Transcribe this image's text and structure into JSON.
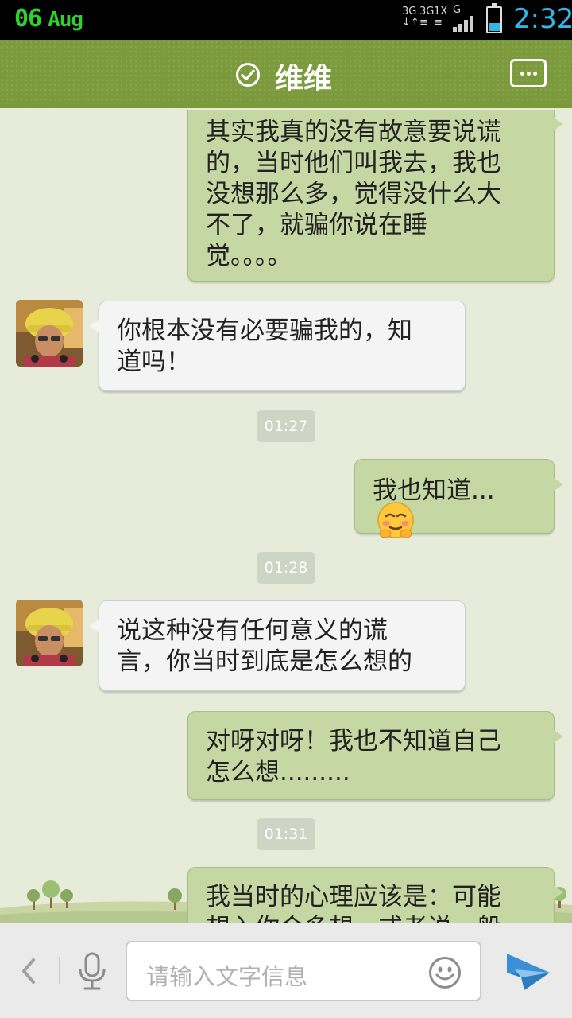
{
  "status_bar": {
    "day": "06",
    "month": "Aug",
    "network_1": "3G",
    "network_2": "3G",
    "network_3": "1X",
    "network_4": "G",
    "time": "2:32",
    "battery_level": 0.35
  },
  "header": {
    "contact_name": "维维"
  },
  "messages": [
    {
      "side": "me",
      "lines": [
        "其实我真的没有故意要说谎",
        "的，当时他们叫我去，我也",
        "没想那么多，觉得没什么大",
        "不了，就骗你说在睡",
        "觉。。。。"
      ]
    },
    {
      "side": "them",
      "lines": [
        "你根本没有必要骗我的，知",
        "道吗！"
      ]
    },
    {
      "side": "time",
      "text": "01:27"
    },
    {
      "side": "me",
      "lines": [
        "我也知道..."
      ],
      "emoji": "embarrassed-face"
    },
    {
      "side": "time",
      "text": "01:28"
    },
    {
      "side": "them",
      "lines": [
        "说这种没有任何意义的谎",
        "言，你当时到底是怎么想的"
      ]
    },
    {
      "side": "me",
      "lines": [
        "对呀对呀！我也不知道自己",
        "怎么想........."
      ]
    },
    {
      "side": "time",
      "text": "01:31"
    },
    {
      "side": "me",
      "lines": [
        "我当时的心理应该是：可能",
        "想入你会多想，或者说一般"
      ]
    }
  ],
  "input_bar": {
    "placeholder": "请输入文字信息"
  },
  "colors": {
    "header": "#7a9a3c",
    "my_bubble": "#c5d8a3",
    "their_bubble": "#f4f4f4",
    "chat_background": "#e6ecd9",
    "clock": "#33b5e5",
    "date": "#2fd12f",
    "send_icon": "#3a8fd6"
  }
}
